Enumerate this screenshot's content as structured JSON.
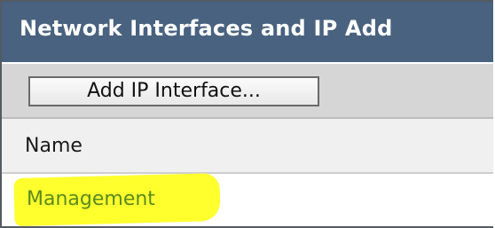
{
  "panel": {
    "title": "Network Interfaces and IP Add"
  },
  "toolbar": {
    "add_button_label": "Add IP Interface..."
  },
  "table": {
    "columns": [
      "Name"
    ],
    "rows": [
      {
        "name": "Management"
      }
    ]
  },
  "colors": {
    "title_bar": "#48627f",
    "toolbar_bg": "#d6d6d6",
    "link": "#5b8a1c",
    "highlight": "#ffff2e"
  }
}
